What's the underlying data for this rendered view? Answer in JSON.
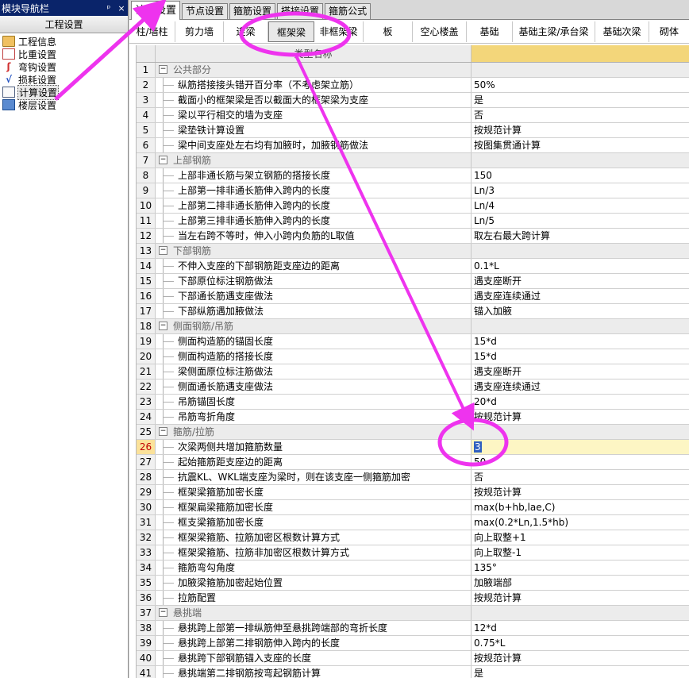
{
  "nav": {
    "title": "模块导航栏",
    "pin": "ᵖ",
    "close": "×",
    "header": "工程设置",
    "items": [
      {
        "label": "工程信息",
        "icon": "folder-icon"
      },
      {
        "label": "比重设置",
        "icon": "scale-icon"
      },
      {
        "label": "弯钩设置",
        "icon": "hook-icon"
      },
      {
        "label": "损耗设置",
        "icon": "loss-icon"
      },
      {
        "label": "计算设置",
        "icon": "calc-icon"
      },
      {
        "label": "楼层设置",
        "icon": "floor-icon"
      }
    ]
  },
  "tabs": [
    "计算设置",
    "节点设置",
    "箍筋设置",
    "搭接设置",
    "箍筋公式"
  ],
  "subtabs": [
    "柱/墙柱",
    "剪力墙",
    "连梁",
    "框架梁",
    "非框架梁",
    "板",
    "空心楼盖",
    "基础",
    "基础主梁/承台梁",
    "基础次梁",
    "砌体"
  ],
  "grid": {
    "header_name": "类型名称",
    "rows": [
      {
        "n": "1",
        "type": "group",
        "name": "公共部分",
        "value": ""
      },
      {
        "n": "2",
        "type": "item",
        "name": "纵筋搭接接头错开百分率（不考虑架立筋）",
        "value": "50%"
      },
      {
        "n": "3",
        "type": "item",
        "name": "截面小的框架梁是否以截面大的框架梁为支座",
        "value": "是"
      },
      {
        "n": "4",
        "type": "item",
        "name": "梁以平行相交的墙为支座",
        "value": "否"
      },
      {
        "n": "5",
        "type": "item",
        "name": "梁垫铁计算设置",
        "value": "按规范计算"
      },
      {
        "n": "6",
        "type": "item",
        "name": "梁中间支座处左右均有加腋时，加腋钢筋做法",
        "value": "按图集贯通计算"
      },
      {
        "n": "7",
        "type": "group",
        "name": "上部钢筋",
        "value": ""
      },
      {
        "n": "8",
        "type": "item",
        "name": "上部非通长筋与架立钢筋的搭接长度",
        "value": "150"
      },
      {
        "n": "9",
        "type": "item",
        "name": "上部第一排非通长筋伸入跨内的长度",
        "value": "Ln/3"
      },
      {
        "n": "10",
        "type": "item",
        "name": "上部第二排非通长筋伸入跨内的长度",
        "value": "Ln/4"
      },
      {
        "n": "11",
        "type": "item",
        "name": "上部第三排非通长筋伸入跨内的长度",
        "value": "Ln/5"
      },
      {
        "n": "12",
        "type": "item",
        "name": "当左右跨不等时，伸入小跨内负筋的L取值",
        "value": "取左右最大跨计算"
      },
      {
        "n": "13",
        "type": "group",
        "name": "下部钢筋",
        "value": ""
      },
      {
        "n": "14",
        "type": "item",
        "name": "不伸入支座的下部钢筋距支座边的距离",
        "value": "0.1*L"
      },
      {
        "n": "15",
        "type": "item",
        "name": "下部原位标注钢筋做法",
        "value": "遇支座断开"
      },
      {
        "n": "16",
        "type": "item",
        "name": "下部通长筋遇支座做法",
        "value": "遇支座连续通过"
      },
      {
        "n": "17",
        "type": "item",
        "name": "下部纵筋遇加腋做法",
        "value": "锚入加腋"
      },
      {
        "n": "18",
        "type": "group",
        "name": "侧面钢筋/吊筋",
        "value": ""
      },
      {
        "n": "19",
        "type": "item",
        "name": "侧面构造筋的锚固长度",
        "value": "15*d"
      },
      {
        "n": "20",
        "type": "item",
        "name": "侧面构造筋的搭接长度",
        "value": "15*d"
      },
      {
        "n": "21",
        "type": "item",
        "name": "梁侧面原位标注筋做法",
        "value": "遇支座断开"
      },
      {
        "n": "22",
        "type": "item",
        "name": "侧面通长筋遇支座做法",
        "value": "遇支座连续通过"
      },
      {
        "n": "23",
        "type": "item",
        "name": "吊筋锚固长度",
        "value": "20*d"
      },
      {
        "n": "24",
        "type": "item",
        "name": "吊筋弯折角度",
        "value": "按规范计算"
      },
      {
        "n": "25",
        "type": "group",
        "name": "箍筋/拉筋",
        "value": ""
      },
      {
        "n": "26",
        "type": "item",
        "name": "次梁两侧共增加箍筋数量",
        "value": "3",
        "selected": true
      },
      {
        "n": "27",
        "type": "item",
        "name": "起始箍筋距支座边的距离",
        "value": "50"
      },
      {
        "n": "28",
        "type": "item",
        "name": "抗震KL、WKL端支座为梁时，则在该支座一侧箍筋加密",
        "value": "否"
      },
      {
        "n": "29",
        "type": "item",
        "name": "框架梁箍筋加密长度",
        "value": "按规范计算"
      },
      {
        "n": "30",
        "type": "item",
        "name": "框架扁梁箍筋加密长度",
        "value": "max(b+hb,lae,C)"
      },
      {
        "n": "31",
        "type": "item",
        "name": "框支梁箍筋加密长度",
        "value": "max(0.2*Ln,1.5*hb)"
      },
      {
        "n": "32",
        "type": "item",
        "name": "框架梁箍筋、拉筋加密区根数计算方式",
        "value": "向上取整+1"
      },
      {
        "n": "33",
        "type": "item",
        "name": "框架梁箍筋、拉筋非加密区根数计算方式",
        "value": "向上取整-1"
      },
      {
        "n": "34",
        "type": "item",
        "name": "箍筋弯勾角度",
        "value": "135°"
      },
      {
        "n": "35",
        "type": "item",
        "name": "加腋梁箍筋加密起始位置",
        "value": "加腋端部"
      },
      {
        "n": "36",
        "type": "item",
        "name": "拉筋配置",
        "value": "按规范计算"
      },
      {
        "n": "37",
        "type": "group",
        "name": "悬挑端",
        "value": ""
      },
      {
        "n": "38",
        "type": "item",
        "name": "悬挑跨上部第一排纵筋伸至悬挑跨端部的弯折长度",
        "value": "12*d"
      },
      {
        "n": "39",
        "type": "item",
        "name": "悬挑跨上部第二排钢筋伸入跨内的长度",
        "value": "0.75*L"
      },
      {
        "n": "40",
        "type": "item",
        "name": "悬挑跨下部钢筋锚入支座的长度",
        "value": "按规范计算"
      },
      {
        "n": "41",
        "type": "item",
        "name": "悬挑端第二排钢筋按弯起钢筋计算",
        "value": "是"
      }
    ]
  },
  "colors": {
    "annotation": "#ee33ee",
    "nav_title_bg": "#0a246a",
    "value_header": "#f3d67a",
    "selected_index": "#fbe29a"
  }
}
